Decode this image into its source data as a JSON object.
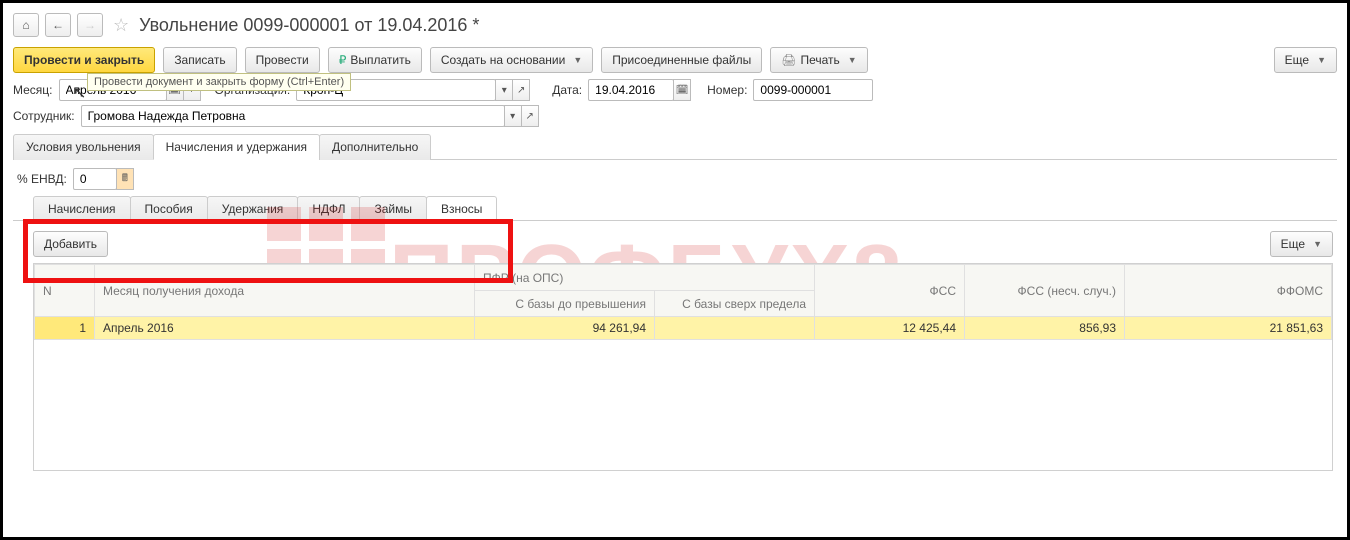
{
  "header": {
    "title": "Увольнение 0099-000001 от 19.04.2016 *"
  },
  "toolbar": {
    "post_close": "Провести и закрыть",
    "save": "Записать",
    "post": "Провести",
    "pay": "Выплатить",
    "create_based": "Создать на основании",
    "attached": "Присоединенные файлы",
    "print": "Печать",
    "more": "Еще",
    "tooltip": "Провести документ и закрыть форму (Ctrl+Enter)"
  },
  "fields": {
    "month_label": "Месяц:",
    "month_value": "Апрель 2016",
    "org_label": "Организация:",
    "org_value": "Крон-Ц",
    "date_label": "Дата:",
    "date_value": "19.04.2016",
    "number_label": "Номер:",
    "number_value": "0099-000001",
    "employee_label": "Сотрудник:",
    "employee_value": "Громова Надежда Петровна"
  },
  "main_tabs": {
    "t1": "Условия увольнения",
    "t2": "Начисления и удержания",
    "t3": "Дополнительно"
  },
  "envd": {
    "label": "% ЕНВД:",
    "value": "0"
  },
  "sub_tabs": {
    "accruals": "Начисления",
    "benefits": "Пособия",
    "deductions": "Удержания",
    "ndfl": "НДФЛ",
    "loans": "Займы",
    "contrib": "Взносы"
  },
  "subtoolbar": {
    "add": "Добавить",
    "more": "Еще"
  },
  "grid": {
    "cols": {
      "n": "N",
      "month": "Месяц получения дохода",
      "pfr_group": "ПФР (на ОПС)",
      "base_under": "С базы до превышения",
      "base_over": "С базы сверх предела",
      "fss": "ФСС",
      "fss_acc": "ФСС (несч. случ.)",
      "ffoms": "ФФОМС"
    },
    "row": {
      "n": "1",
      "month": "Апрель 2016",
      "base_under": "94 261,94",
      "base_over": "",
      "fss": "12 425,44",
      "fss_acc": "856,93",
      "ffoms": "21 851,63"
    }
  }
}
